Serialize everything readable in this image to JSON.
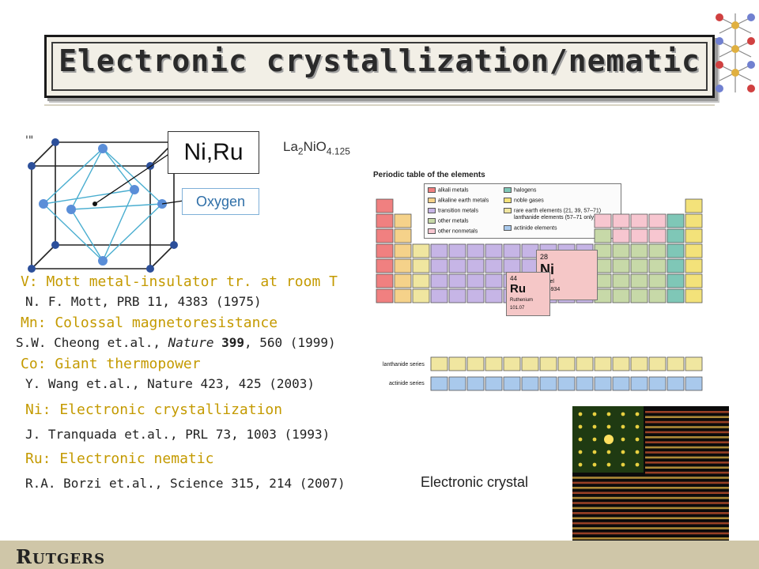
{
  "title": "Electronic crystallization/nematic",
  "crystal": {
    "tick": "'\"",
    "metal_label": "Ni,Ru",
    "oxygen_label": "Oxygen",
    "formula_base": "La",
    "formula_sub1": "2",
    "formula_mid": "NiO",
    "formula_sub2": "4.125"
  },
  "items": [
    {
      "heading": "V: Mott metal-insulator tr. at room T",
      "ref": "N. F. Mott, PRB 11, 4383 (1975)"
    },
    {
      "heading": "Mn: Colossal magnetoresistance",
      "ref_pre": "S.W. Cheong et.al., ",
      "ref_journal": "Nature",
      "ref_vol": "399",
      "ref_post": ", 560 (1999)"
    },
    {
      "heading": "Co: Giant thermopower",
      "ref": "Y. Wang et.al., Nature 423, 425 (2003)"
    },
    {
      "heading": "Ni: Electronic crystallization",
      "ref": "J. Tranquada et.al., PRL 73, 1003 (1993)"
    },
    {
      "heading": "Ru: Electronic nematic",
      "ref": "R.A. Borzi et.al., Science 315, 214 (2007)"
    }
  ],
  "periodic_table": {
    "title": "Periodic table of the elements",
    "legend": [
      "alkali metals",
      "alkaline earth metals",
      "transition metals",
      "other metals",
      "other nonmetals",
      "halogens",
      "noble gases",
      "rare earth elements (21, 39, 57–71)",
      "lanthanide elements (57–71 only)",
      "actinide elements"
    ],
    "lanthanide_label": "lanthanide series",
    "actinide_label": "actinide series",
    "ni_card": {
      "number": "28",
      "symbol": "Ni",
      "name": "nickel",
      "mass": "58.6934"
    },
    "ru_card": {
      "number": "44",
      "symbol": "Ru",
      "name": "Ruthenium",
      "mass": "101.07"
    },
    "colors": {
      "alkali": "#f08080",
      "alkaline": "#f5d28a",
      "transition": "#c6b5e6",
      "other_metals": "#c7d9a8",
      "nonmetal": "#f7c6d0",
      "halogen": "#7fc7b7",
      "noble": "#f3e27a",
      "rare": "#f0e6a0",
      "actinide": "#a9c9ec"
    }
  },
  "ecrystal_label": "Electronic crystal",
  "footer": {
    "logo_r": "R",
    "logo_rest": "UTGERS"
  }
}
